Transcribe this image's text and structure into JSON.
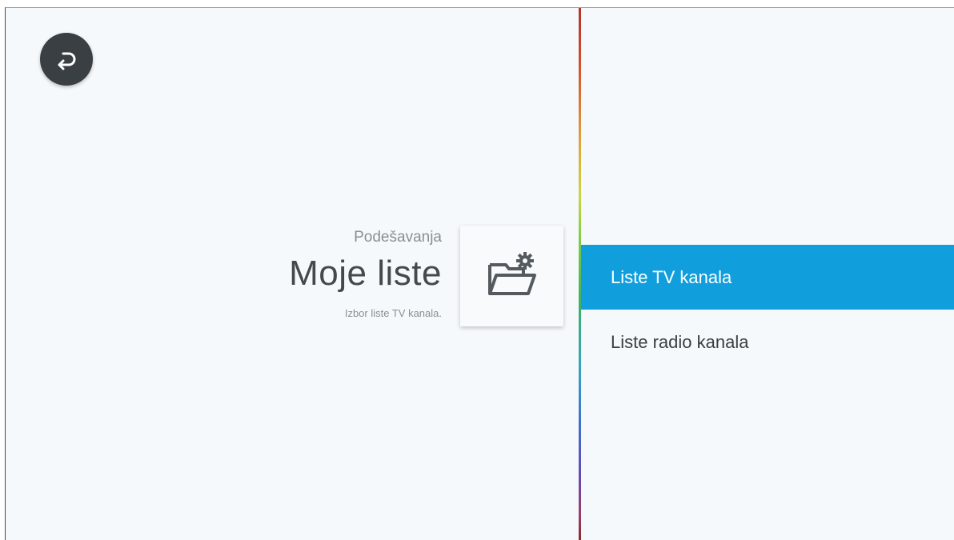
{
  "back_button": {
    "icon": "back-arrow-icon"
  },
  "header": {
    "breadcrumb": "Podešavanja",
    "title": "Moje liste",
    "description": "Izbor liste TV kanala."
  },
  "icon_card": {
    "icon": "folder-settings-icon"
  },
  "menu": {
    "items": [
      {
        "label": "Liste TV kanala",
        "selected": true
      },
      {
        "label": "Liste radio kanala",
        "selected": false
      }
    ]
  },
  "colors": {
    "background": "#f6f9fb",
    "accent": "#109fdc",
    "back_button": "#3a3f44",
    "title_text": "#45494d",
    "secondary_text": "#8a8f93"
  }
}
